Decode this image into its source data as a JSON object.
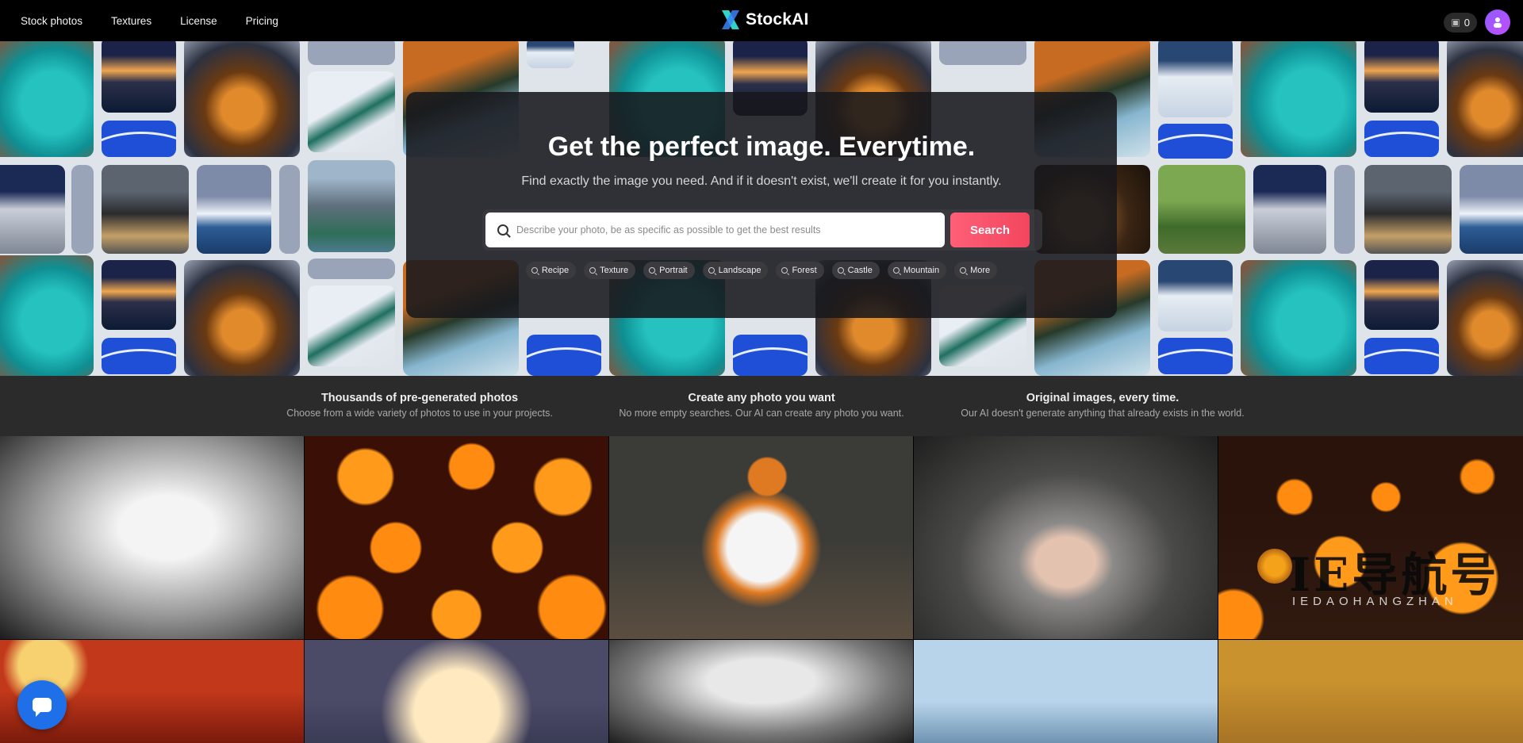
{
  "nav": {
    "links": [
      "Stock photos",
      "Textures",
      "License",
      "Pricing"
    ],
    "brand": "StockAI",
    "credits": "0",
    "avatar_icon": "user-avatar-icon"
  },
  "hero": {
    "title": "Get the perfect image. Everytime.",
    "subtitle": "Find exactly the image you need. And if it doesn't exist, we'll create it for you instantly.",
    "search": {
      "placeholder": "Describe your photo, be as specific as possible to get the best results",
      "value": "",
      "button_label": "Search"
    },
    "chips": [
      "Recipe",
      "Texture",
      "Portrait",
      "Landscape",
      "Forest",
      "Castle",
      "Mountain",
      "More"
    ]
  },
  "features": [
    {
      "title": "Thousands of pre-generated photos",
      "desc": "Choose from a wide variety of photos to use in your projects."
    },
    {
      "title": "Create any photo you want",
      "desc": "No more empty searches. Our AI can create any photo you want."
    },
    {
      "title": "Original images, every time.",
      "desc": "Our AI doesn't generate anything that already exists in the world."
    }
  ],
  "watermark": {
    "glyphs": "IE导航号",
    "sub": "IEDAOHANGZHAN"
  },
  "colors": {
    "accent": "#f2465e",
    "chat_button": "#1e6fe8",
    "panel": "#18181c"
  }
}
